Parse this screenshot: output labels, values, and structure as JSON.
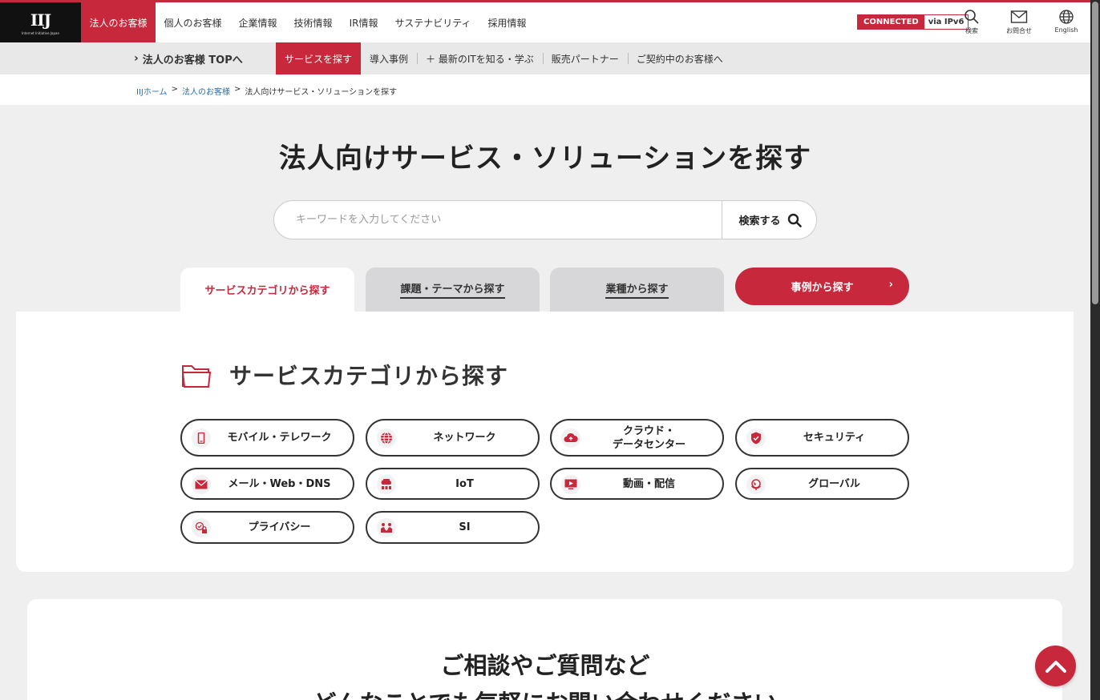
{
  "header": {
    "logo_text": "IIJ",
    "logo_sub": "Internet Initiative Japan",
    "nav": [
      "法人のお客様",
      "個人のお客様",
      "企業情報",
      "技術情報",
      "IR情報",
      "サステナビリティ",
      "採用情報"
    ],
    "connected": "CONNECTED",
    "via": "via IPv6",
    "search_label": "検索",
    "contact_label": "お問合せ",
    "english_label": "English"
  },
  "subnav": {
    "home": "法人のお客様 TOPへ",
    "tabs": [
      "サービスを探す",
      "導入事例",
      "＋ 最新のITを知る・学ぶ",
      "販売パートナー",
      "ご契約中のお客様へ"
    ]
  },
  "breadcrumb": {
    "home": "IIJホーム",
    "sep": ">",
    "level1": "法人のお客様",
    "current": "法人向けサービス・ソリューションを探す"
  },
  "page_title": "法人向けサービス・ソリューションを探す",
  "search": {
    "placeholder": "キーワードを入力してください",
    "button": "検索する"
  },
  "category_tabs": [
    "サービスカテゴリから探す",
    "課題・テーマから探す",
    "業種から探す"
  ],
  "case_button": "事例から探す",
  "section_title": "サービスカテゴリから探す",
  "categories": [
    {
      "label": "モバイル・テレワーク",
      "icon": "mobile-icon"
    },
    {
      "label": "ネットワーク",
      "icon": "globe-network-icon"
    },
    {
      "label": "クラウド・\nデータセンター",
      "icon": "cloud-icon"
    },
    {
      "label": "セキュリティ",
      "icon": "shield-icon"
    },
    {
      "label": "メール・Web・DNS",
      "icon": "mail-icon"
    },
    {
      "label": "IoT",
      "icon": "iot-icon"
    },
    {
      "label": "動画・配信",
      "icon": "video-icon"
    },
    {
      "label": "グローバル",
      "icon": "globe-icon"
    },
    {
      "label": "プライバシー",
      "icon": "privacy-lock-icon"
    },
    {
      "label": "SI",
      "icon": "si-icon"
    }
  ],
  "contact": {
    "line1": "ご相談やご質問など",
    "line2": "どんなことでも気軽にお問い合わせください"
  },
  "colors": {
    "accent": "#c8283c",
    "bg": "#efefef"
  }
}
